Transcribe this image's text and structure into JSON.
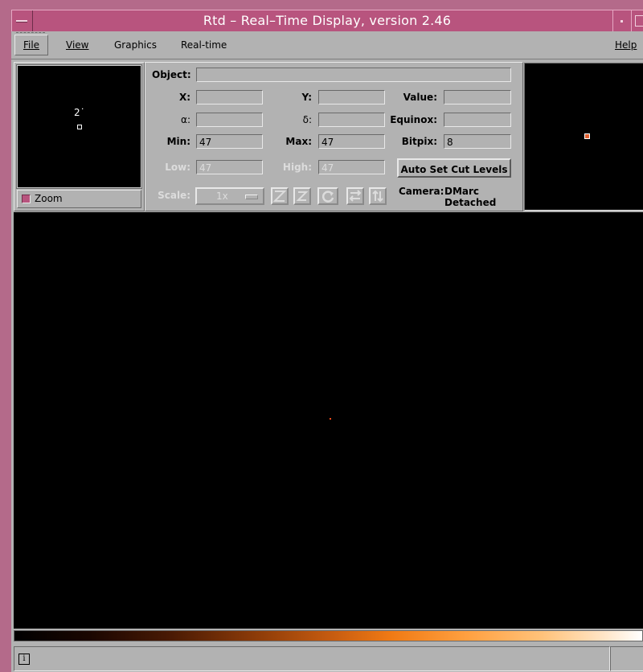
{
  "window": {
    "title": "Rtd – Real–Time Display, version 2.46"
  },
  "menubar": {
    "file": "File",
    "view": "View",
    "graphics": "Graphics",
    "realtime": "Real-time",
    "help": "Help"
  },
  "pan": {
    "label": "2˙",
    "zoom_label": "Zoom",
    "zoom_checked": true
  },
  "info": {
    "object_label": "Object:",
    "object_value": "",
    "x_label": "X:",
    "x_value": "",
    "y_label": "Y:",
    "y_value": "",
    "value_label": "Value:",
    "value_value": "",
    "alpha_label": "α:",
    "alpha_value": "",
    "delta_label": "δ:",
    "delta_value": "",
    "equinox_label": "Equinox:",
    "equinox_value": "",
    "min_label": "Min:",
    "min_value": "47",
    "max_label": "Max:",
    "max_value": "47",
    "bitpix_label": "Bitpix:",
    "bitpix_value": "8",
    "low_label": "Low:",
    "low_value": "47",
    "high_label": "High:",
    "high_value": "47",
    "autoset_label": "Auto Set Cut Levels",
    "scale_label": "Scale:",
    "scale_value": "1x",
    "camera_label": "Camera:",
    "camera_name": "DMarc",
    "camera_status": "Detached"
  },
  "toolbar_icons": [
    "flip-z-icon",
    "z-icon",
    "rotate-icon",
    "flip-x-icon",
    "flip-y-icon"
  ],
  "colors": {
    "title_bar": "#b8547e",
    "panel_bg": "#b2b2b2",
    "image_bg": "#000000",
    "toggle_indicator": "#b8547e"
  },
  "status": {
    "icon": "i",
    "message": ""
  }
}
